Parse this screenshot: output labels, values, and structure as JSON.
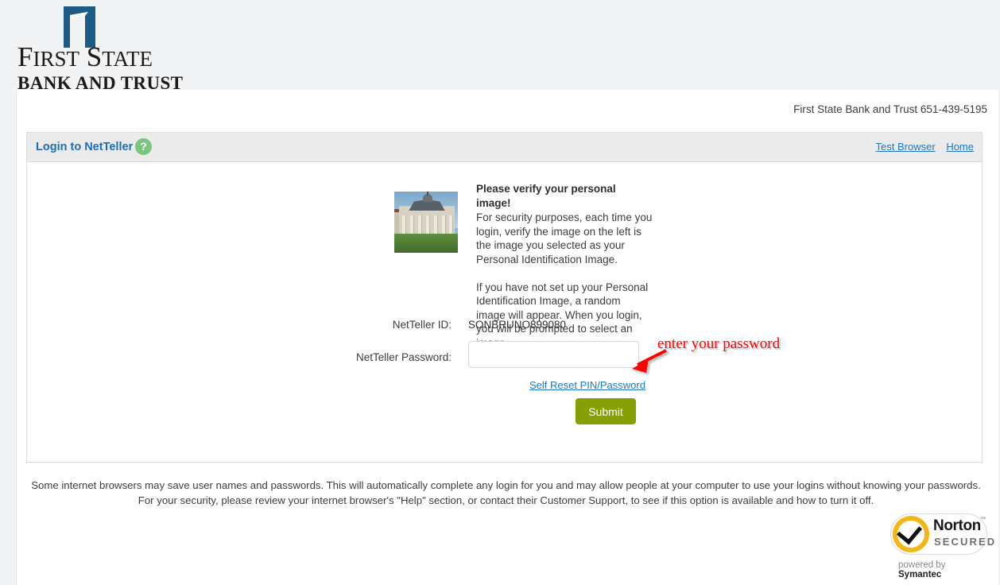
{
  "brand": {
    "line1_part1": "F",
    "line1_part2": "IRST",
    "line1_part3": "S",
    "line1_part4": "TATE",
    "line2": "BANK AND TRUST",
    "logo_icon": "open-door-icon",
    "logo_color": "#1d5b86"
  },
  "header": {
    "contact": "First State Bank and Trust 651-439-5195"
  },
  "panel": {
    "title": "Login to NetTeller",
    "help_icon": "?",
    "links": [
      {
        "label": "Test Browser"
      },
      {
        "label": "Home"
      }
    ],
    "title_color": "#1f6eb5",
    "help_color": "#7cc47f"
  },
  "verify": {
    "heading": "Please verify your personal image!",
    "paragraph1": "For security purposes, each time you login, verify the image on the left is the image you selected as your Personal Identification Image.",
    "paragraph2": "If you have not set up your Personal Identification Image, a random image will appear. When you login, you will be prompted to select an image.",
    "image_alt": "personal-identification-image"
  },
  "form": {
    "id_label": "NetTeller ID:",
    "id_value": "SONBRUNO899080",
    "password_label": "NetTeller Password:",
    "password_value": "",
    "password_placeholder": "",
    "reset_link": "Self Reset PIN/Password",
    "submit_label": "Submit",
    "submit_color": "#86a004"
  },
  "annotation": {
    "text": "enter your password",
    "color": "#ff0000"
  },
  "footer": {
    "disclaimer": "Some internet browsers may save user names and passwords. This will automatically complete any login for you and may allow people at your computer to use your logins without knowing your passwords. For your security, please review your internet browser's \"Help\" section, or contact their Customer Support, to see if this option is available and how to turn it off."
  },
  "norton": {
    "brand": "Norton",
    "trademark": "™",
    "secured": "SECURED",
    "powered_prefix": "powered by ",
    "powered_brand": "Symantec",
    "badge_color": "#f5b718"
  }
}
